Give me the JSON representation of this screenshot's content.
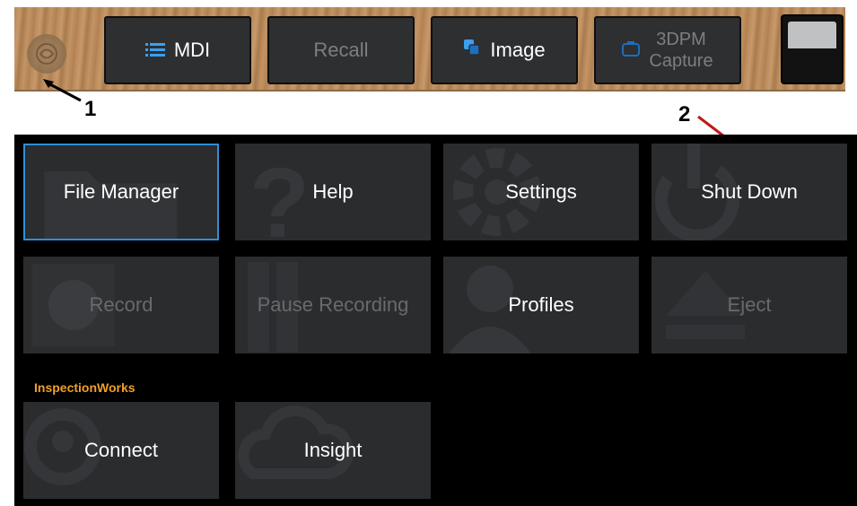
{
  "toolbar": {
    "mdi_label": "MDI",
    "recall_label": "Recall",
    "image_label": "Image",
    "capture_line1": "3DPM",
    "capture_line2": "Capture"
  },
  "callouts": {
    "one": "1",
    "two": "2"
  },
  "menu": {
    "file_manager": "File Manager",
    "help": "Help",
    "settings": "Settings",
    "shut_down": "Shut Down",
    "record": "Record",
    "pause_recording": "Pause Recording",
    "profiles": "Profiles",
    "eject": "Eject",
    "section_inspectionworks": "InspectionWorks",
    "connect": "Connect",
    "insight": "Insight"
  },
  "colors": {
    "accent": "#2e8fd8",
    "section": "#f0a028",
    "tile": "#2a2c2e"
  }
}
